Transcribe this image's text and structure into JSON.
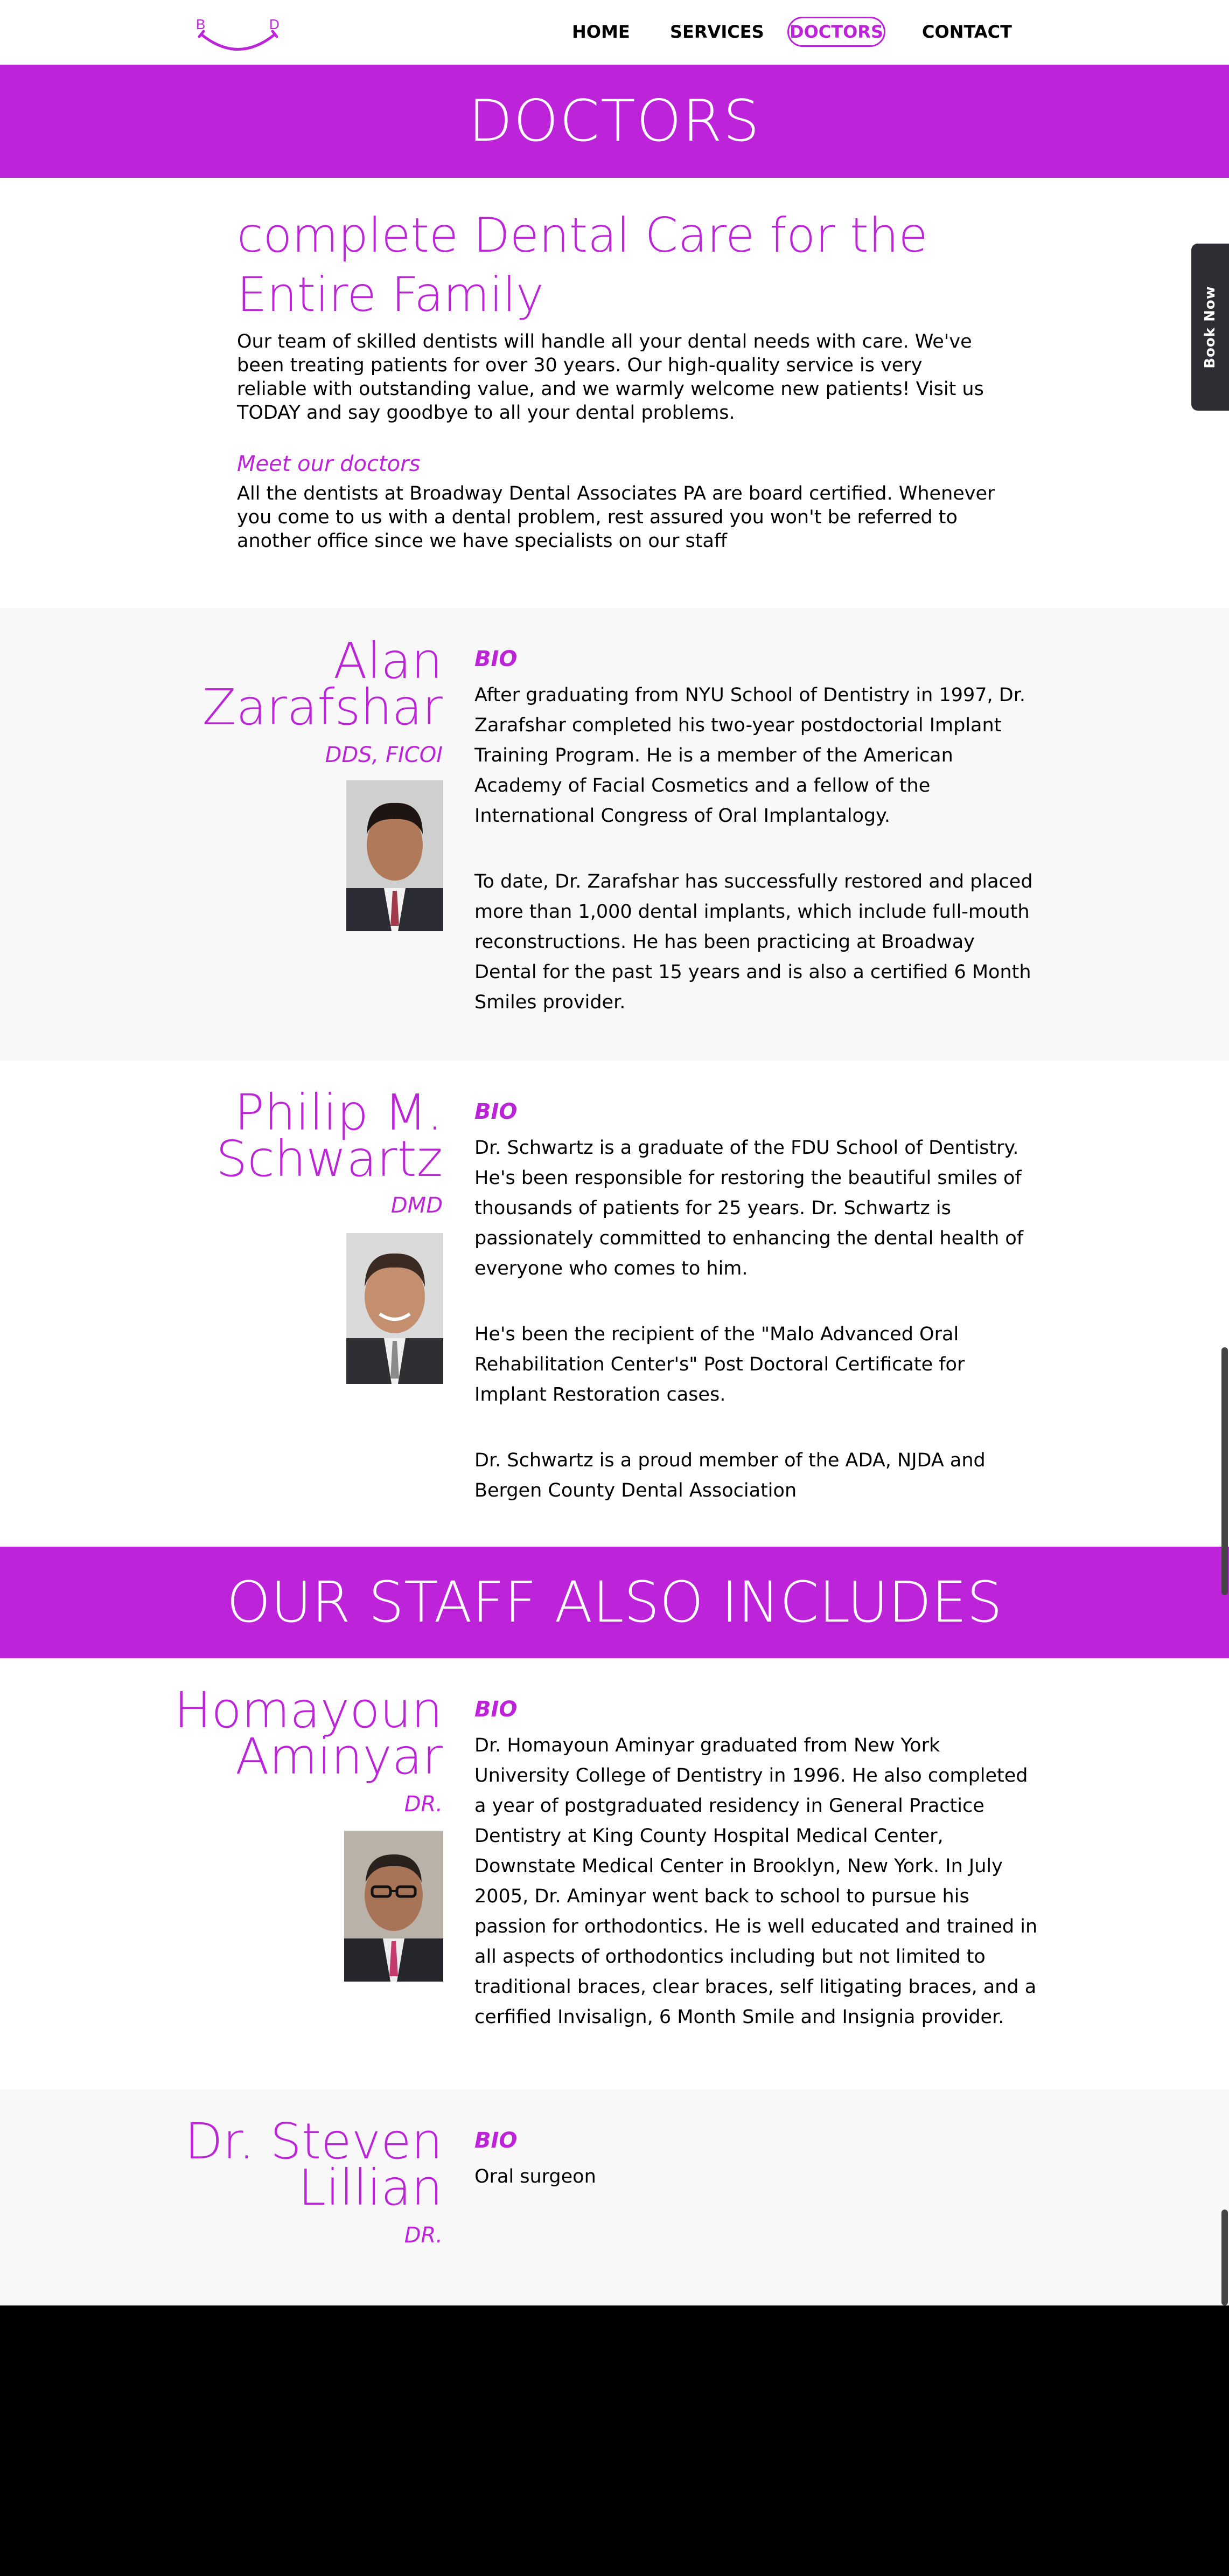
{
  "nav": {
    "logo_letters": [
      "B",
      "D"
    ],
    "items": [
      "HOME",
      "SERVICES",
      "DOCTORS",
      "CONTACT"
    ],
    "active": "DOCTORS"
  },
  "banner_title": "DOCTORS",
  "intro": {
    "title": "complete Dental Care for the Entire Family",
    "text": "Our team of skilled dentists will handle all your dental needs with care. We've been treating patients for over 30 years. Our high-quality service is very reliable with outstanding value, and we warmly welcome new patients! Visit us TODAY and say goodbye to all your dental problems.",
    "subheading": "Meet our doctors",
    "text2": "All the dentists at Broadway Dental Associates PA are board certified. Whenever you come to us with a dental problem, rest assured you won't be referred to another office since we have specialists on our staff"
  },
  "book_now": "Book Now",
  "doctors": [
    {
      "name": "Alan Zarafshar",
      "credentials": "DDS, FICOI",
      "bio_label": "BIO",
      "bio": [
        "After graduating from NYU School of Dentistry in 1997, Dr. Zarafshar completed his two-year postdoctorial Implant Training Program. He is a member of the American Academy of Facial Cosmetics and a fellow of the International Congress of Oral Implantalogy.",
        "To date, Dr. Zarafshar has successfully restored and placed more than 1,000 dental implants, which include full-mouth reconstructions. He has been practicing at Broadway Dental for the past 15 years and is also a certified 6 Month Smiles provider."
      ]
    },
    {
      "name": "Philip M. Schwartz",
      "credentials": "DMD",
      "bio_label": "BIO",
      "bio": [
        "Dr. Schwartz is a graduate of the FDU School of Dentistry. He's been responsible for restoring the beautiful smiles of thousands of patients for 25 years. Dr. Schwartz is passionately committed to enhancing the dental health of everyone who comes to him.",
        "He's been the recipient of the \"Malo Advanced Oral Rehabilitation Center's\" Post Doctoral Certificate for Implant Restoration cases.",
        "Dr. Schwartz is a proud member of the ADA, NJDA and Bergen County Dental Association"
      ]
    }
  ],
  "staff_banner": "OUR STAFF ALSO INCLUDES",
  "staff": [
    {
      "name": "Homayoun Aminyar",
      "credentials": "DR.",
      "bio_label": "BIO",
      "bio": [
        "Dr. Homayoun Aminyar graduated from New York University College of Dentistry in 1996. He also completed a year of postgraduated residency in General Practice Dentistry at King County Hospital Medical Center, Downstate Medical Center in Brooklyn, New York. In July 2005, Dr. Aminyar went back to school to pursue his passion for orthodontics. He is well educated and trained in all aspects of orthodontics including but not limited to traditional braces, clear braces, self litigating braces, and a cerfified Invisalign, 6 Month Smile and Insignia provider."
      ]
    },
    {
      "name": "Dr. Steven Lillian",
      "credentials": "DR.",
      "bio_label": "BIO",
      "bio": [
        "Oral surgeon"
      ]
    }
  ],
  "colors": {
    "accent": "#bd24d9",
    "grey_section": "#f8f8f8",
    "footer": "#000000",
    "book_tab": "#2c2e33"
  }
}
